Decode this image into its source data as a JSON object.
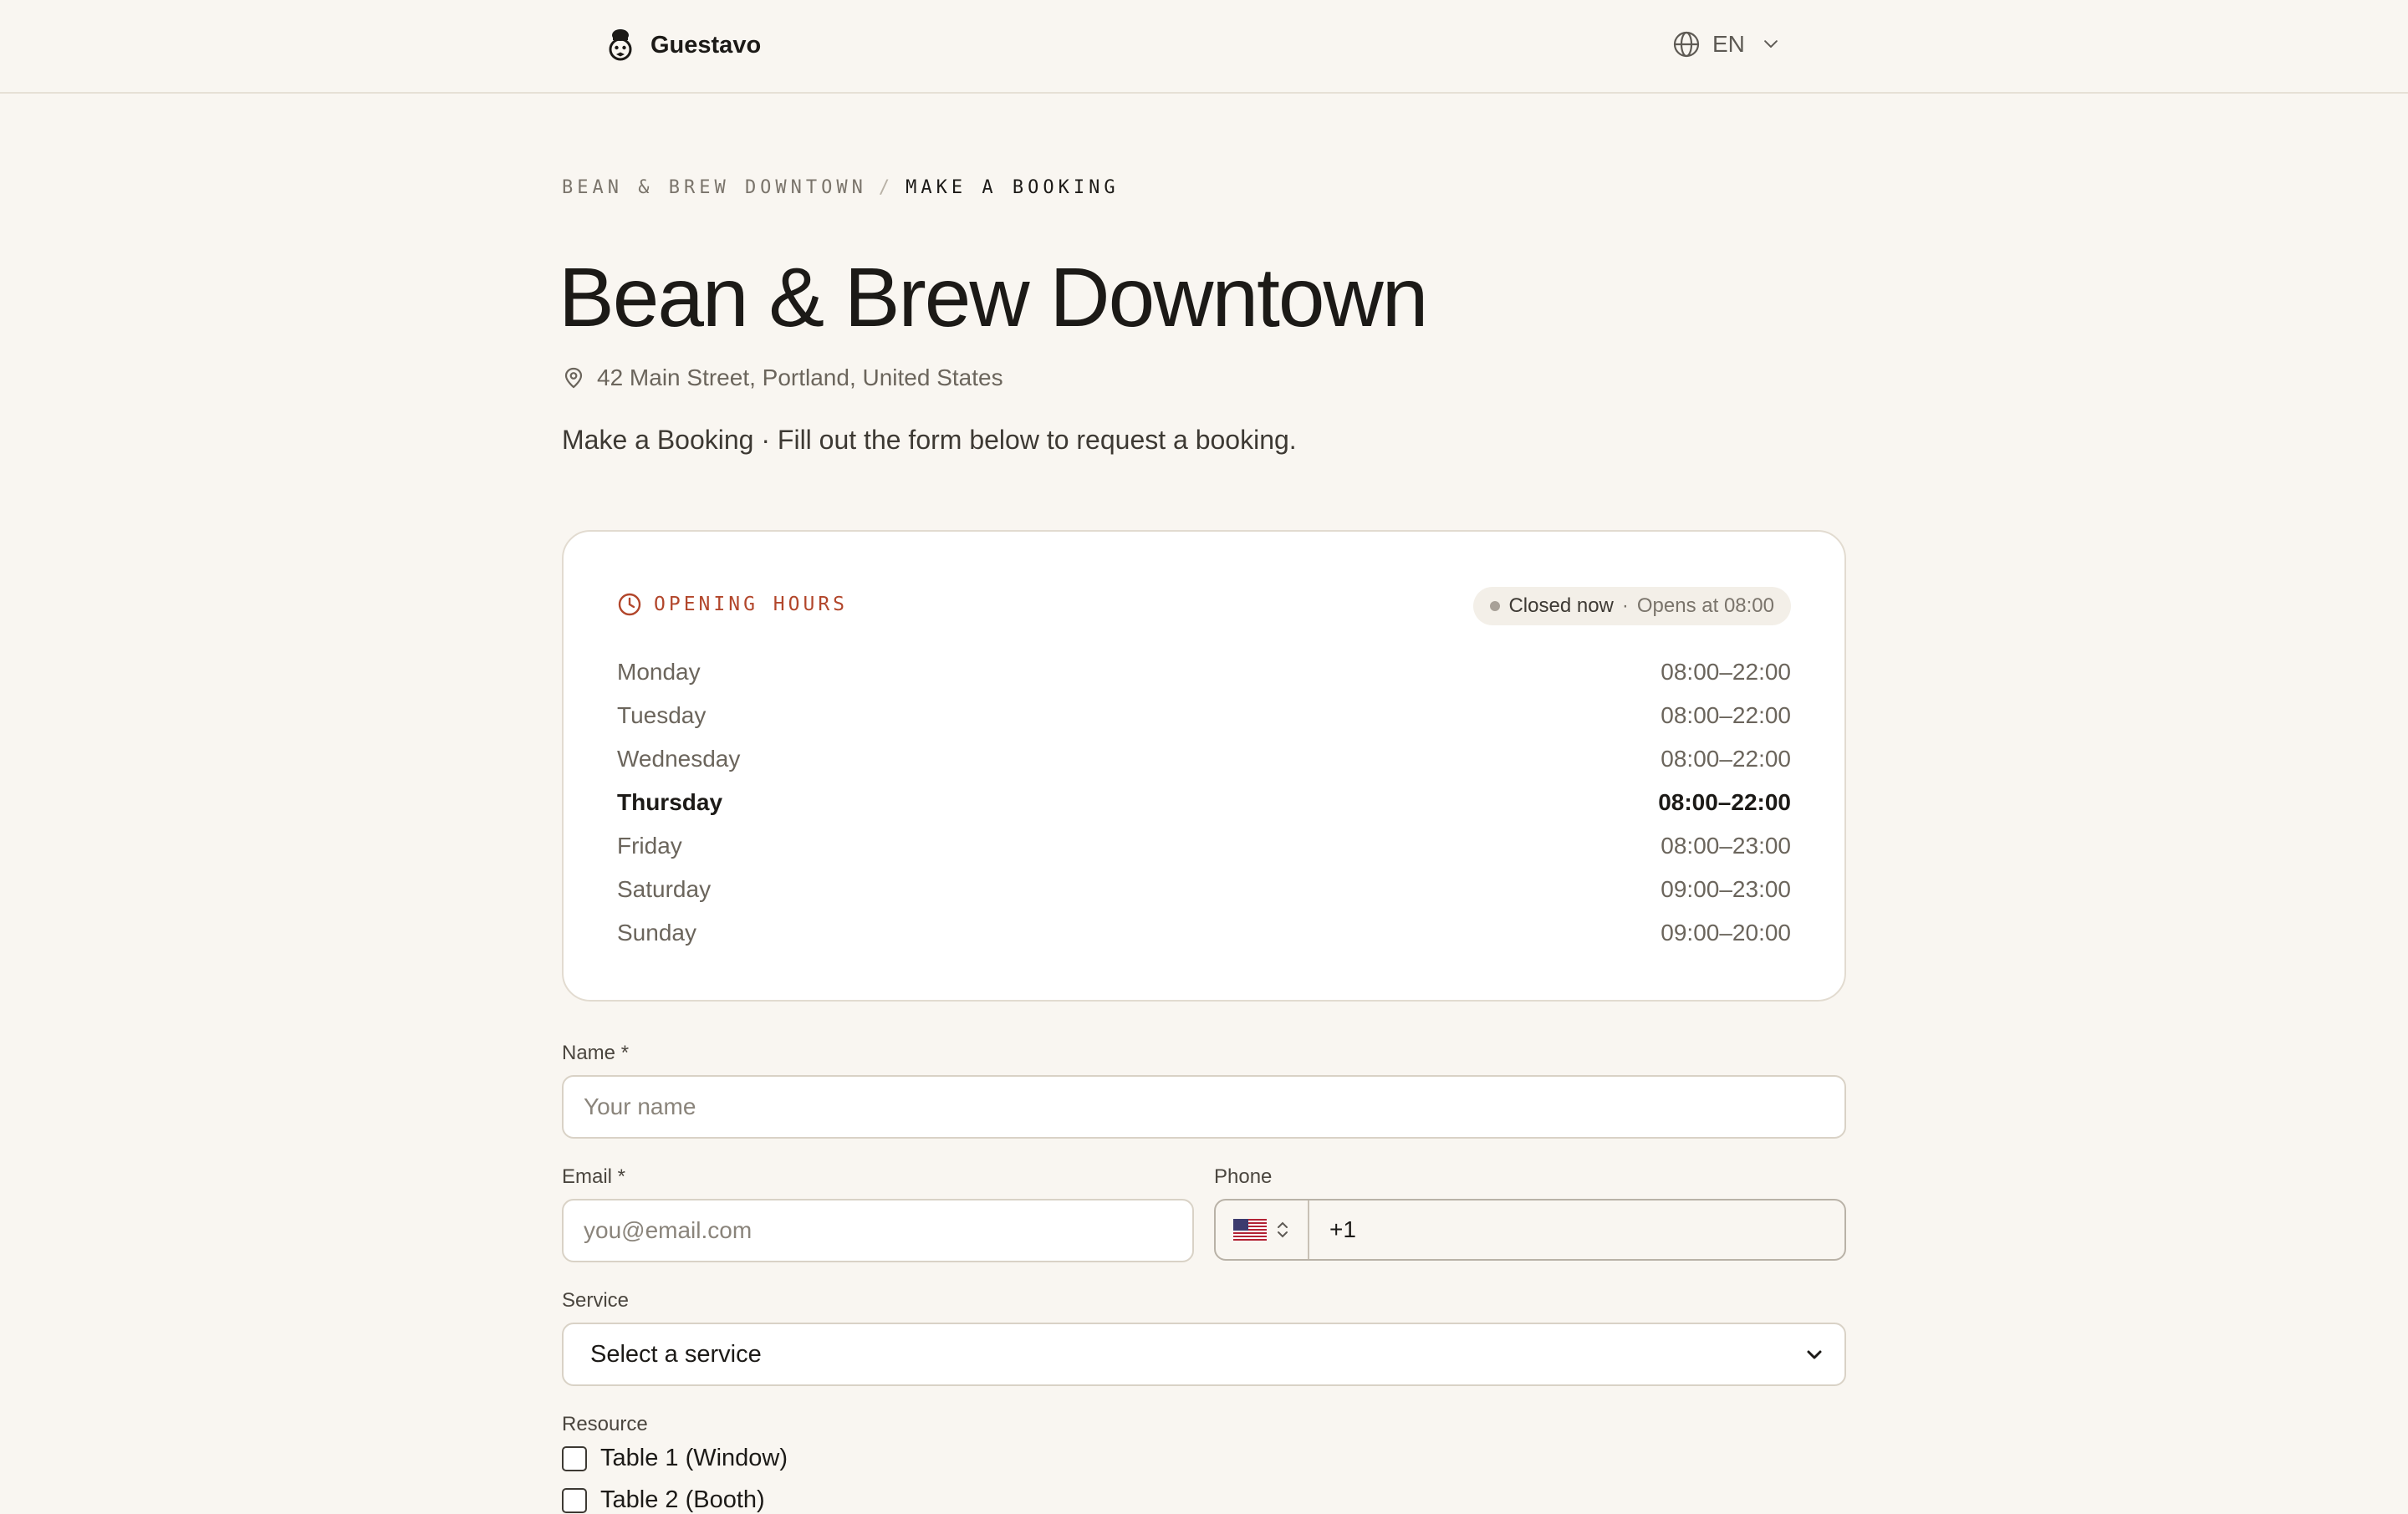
{
  "header": {
    "brand_name": "Guestavo",
    "language": "EN"
  },
  "breadcrumb": {
    "parent": "BEAN & BREW DOWNTOWN",
    "separator": "/",
    "current": "MAKE A BOOKING"
  },
  "venue": {
    "name": "Bean & Brew Downtown",
    "address": "42 Main Street, Portland, United States",
    "subtitle": "Make a Booking · Fill out the form below to request a booking."
  },
  "opening_hours": {
    "label": "OPENING HOURS",
    "status": "Closed now",
    "status_separator": "·",
    "status_detail": "Opens at 08:00",
    "days": [
      {
        "day": "Monday",
        "hours": "08:00–22:00"
      },
      {
        "day": "Tuesday",
        "hours": "08:00–22:00"
      },
      {
        "day": "Wednesday",
        "hours": "08:00–22:00"
      },
      {
        "day": "Thursday",
        "hours": "08:00–22:00"
      },
      {
        "day": "Friday",
        "hours": "08:00–23:00"
      },
      {
        "day": "Saturday",
        "hours": "09:00–23:00"
      },
      {
        "day": "Sunday",
        "hours": "09:00–20:00"
      }
    ]
  },
  "form": {
    "name_label": "Name *",
    "name_placeholder": "Your name",
    "email_label": "Email *",
    "email_placeholder": "you@email.com",
    "phone_label": "Phone",
    "phone_value": "+1",
    "service_label": "Service",
    "service_selected": "Select a service",
    "resource_label": "Resource",
    "resources": [
      "Table 1 (Window)",
      "Table 2 (Booth)"
    ]
  },
  "icons": {
    "logo": "chef-mascot-icon",
    "language": "globe-icon",
    "language_dropdown": "chevron-down-icon",
    "address": "map-pin-icon",
    "hours": "clock-icon",
    "country": "us-flag-icon"
  },
  "colors": {
    "background": "#f9f6f1",
    "accent": "#b2462b",
    "text": "#1c1a17",
    "card": "#ffffff"
  }
}
